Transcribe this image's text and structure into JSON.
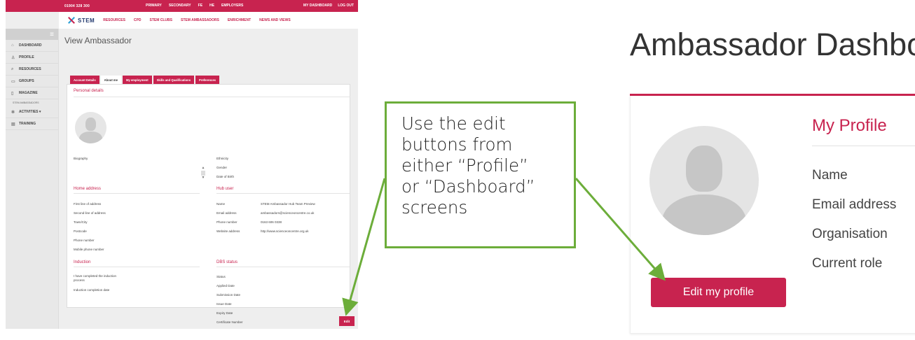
{
  "left_screen": {
    "topbar": {
      "phone": "01904 328 300",
      "nav": [
        "PRIMARY",
        "SECONDARY",
        "FE",
        "HE",
        "EMPLOYERS"
      ],
      "right_links": [
        "MY DASHBOARD",
        "LOG OUT"
      ]
    },
    "logo_text": "STEM",
    "main_nav": [
      "RESOURCES",
      "CPD",
      "STEM CLUBS",
      "STEM AMBASSADORS",
      "ENRICHMENT",
      "NEWS AND VIEWS"
    ],
    "sidebar": {
      "items": [
        {
          "label": "DASHBOARD",
          "icon": "home-icon",
          "glyph": "⌂"
        },
        {
          "label": "PROFILE",
          "icon": "user-icon",
          "glyph": "♙"
        },
        {
          "label": "RESOURCES",
          "icon": "search-icon",
          "glyph": "⌕"
        },
        {
          "label": "GROUPS",
          "icon": "chat-icon",
          "glyph": "▭"
        },
        {
          "label": "MAGAZINE",
          "icon": "document-icon",
          "glyph": "▯"
        }
      ],
      "subheading": "STEM AMBASSADORS",
      "items2": [
        {
          "label": "ACTIVITIES ▾",
          "icon": "activities-icon",
          "glyph": "✱"
        },
        {
          "label": "TRAINING",
          "icon": "training-icon",
          "glyph": "▤"
        }
      ]
    },
    "page_title": "View Ambassador",
    "tabs": [
      "Account Details",
      "About me",
      "My employment",
      "Skills and Qualifications",
      "Preferences"
    ],
    "active_tab": "About me",
    "sections": {
      "personal": "Personal details",
      "home": "Home address",
      "hub": "Hub user",
      "induction": "Induction",
      "dbs": "DBS status"
    },
    "biography_label": "Biography",
    "personal_right": [
      "Ethnicity",
      "Gender",
      "Date of Birth"
    ],
    "home_fields": [
      "First line of address",
      "Second line of address",
      "Town/City",
      "Postcode",
      "Phone number",
      "Mobile phone number"
    ],
    "hub_fields": [
      "Name",
      "Email address",
      "Phone number",
      "Website address"
    ],
    "hub_values": [
      "STEM Ambassador Hub Team Preview",
      "ambassadors@scienceoncentre.co.uk",
      "0163 606 0338",
      "http://www.scienceoncentre.org.uk"
    ],
    "induction_fields": [
      "I have completed the induction process",
      "Induction completion date"
    ],
    "dbs_fields": [
      "Status",
      "Applied Date",
      "Submission Date",
      "Issue Date",
      "Expiry Date",
      "Certificate Number"
    ],
    "edit_label": "Edit"
  },
  "callout": {
    "lines": [
      "Use the edit",
      "buttons from",
      "either “Profile”",
      "or “Dashboard”",
      "screens"
    ],
    "border_color": "#6cad3a"
  },
  "right_screen": {
    "title": "Ambassador Dashboard",
    "card_title": "My Profile",
    "fields": [
      "Name",
      "Email address",
      "Organisation",
      "Current role"
    ],
    "edit_button": "Edit my profile",
    "accent": "#c8234f"
  }
}
